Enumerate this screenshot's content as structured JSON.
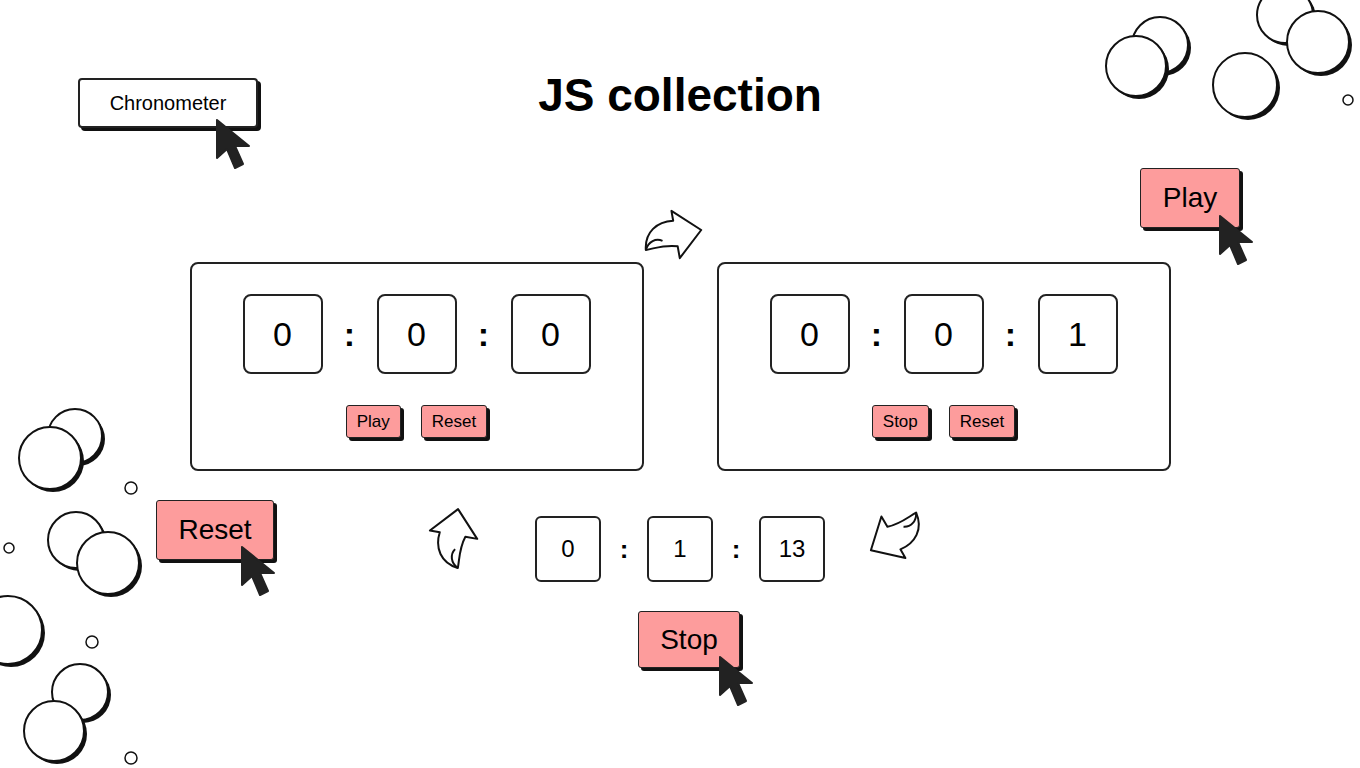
{
  "title": "JS collection",
  "menu_button": {
    "label": "Chronometer"
  },
  "floating_buttons": [
    {
      "label": "Play"
    },
    {
      "label": "Reset"
    },
    {
      "label": "Stop"
    }
  ],
  "separator": ":",
  "panels": [
    {
      "hours": "0",
      "minutes": "0",
      "seconds": "0",
      "buttons": [
        "Play",
        "Reset"
      ]
    },
    {
      "hours": "0",
      "minutes": "0",
      "seconds": "1",
      "buttons": [
        "Stop",
        "Reset"
      ]
    }
  ],
  "bottom_timer": {
    "hours": "0",
    "minutes": "1",
    "seconds": "13"
  }
}
